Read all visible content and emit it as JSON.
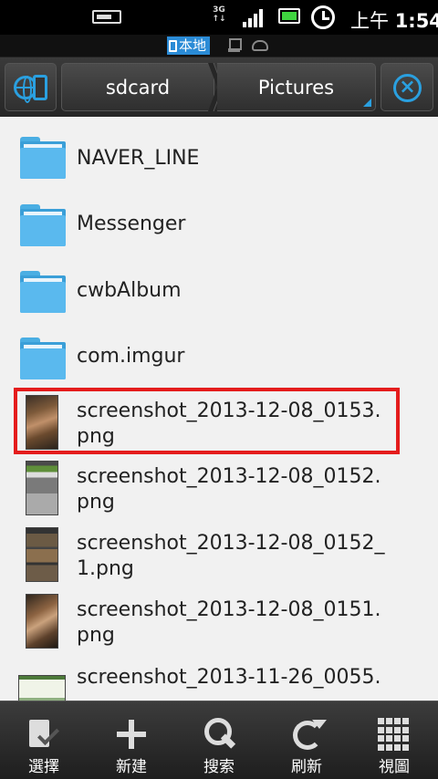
{
  "status_bar": {
    "network": "3G",
    "time_prefix": "上午",
    "time": "1:54"
  },
  "location_bar": {
    "local_label": "本地"
  },
  "toolbar": {
    "path": [
      "sdcard",
      "Pictures"
    ]
  },
  "files": [
    {
      "name": "NAVER_LINE",
      "type": "folder"
    },
    {
      "name": "Messenger",
      "type": "folder"
    },
    {
      "name": "cwbAlbum",
      "type": "folder"
    },
    {
      "name": "com.imgur",
      "type": "folder"
    },
    {
      "name_line1": "screenshot_2013-12-08_0153.",
      "name_line2": "png",
      "type": "image",
      "selected": true
    },
    {
      "name_line1": "screenshot_2013-12-08_0152.",
      "name_line2": "png",
      "type": "image"
    },
    {
      "name_line1": "screenshot_2013-12-08_0152_",
      "name_line2": "1.png",
      "type": "image"
    },
    {
      "name_line1": "screenshot_2013-12-08_0151.",
      "name_line2": "png",
      "type": "image"
    },
    {
      "name_line1": "screenshot_2013-11-26_0055.",
      "name_line2": "",
      "type": "image"
    }
  ],
  "bottom_bar": [
    {
      "label": "選擇",
      "icon": "select-icon"
    },
    {
      "label": "新建",
      "icon": "new-icon"
    },
    {
      "label": "搜索",
      "icon": "search-icon"
    },
    {
      "label": "刷新",
      "icon": "refresh-icon"
    },
    {
      "label": "視圖",
      "icon": "view-grid-icon"
    }
  ],
  "colors": {
    "accent": "#2aa0e0",
    "folder": "#5ab9ee",
    "highlight": "#e41c1c",
    "list_bg": "#f1f1f1"
  }
}
